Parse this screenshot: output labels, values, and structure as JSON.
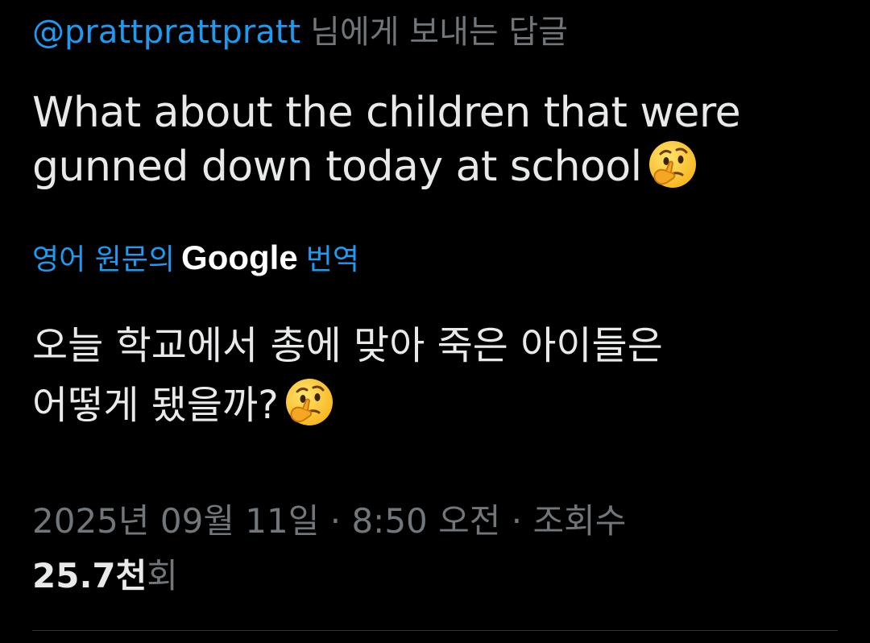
{
  "reply": {
    "mention": "@prattprattpratt",
    "suffix": "님에게 보내는 답글"
  },
  "tweet": {
    "text_line1": "What about the children that were",
    "text_line2": "gunned down today at school",
    "emoji": "thinking-face"
  },
  "translation": {
    "prefix": "영어 원문의",
    "brand": "Google",
    "suffix": "번역",
    "text_line1": "오늘 학교에서 총에 맞아 죽은 아이들은",
    "text_line2": "어떻게 됐을까?"
  },
  "meta": {
    "line": "2025년 09월 11일 · 8:50 오전 · 조회수",
    "views_count": "25.7천",
    "views_unit": "회"
  },
  "colors": {
    "background": "#000000",
    "text": "#e7e9ea",
    "muted": "#71767b",
    "accent": "#1d9bf0"
  }
}
